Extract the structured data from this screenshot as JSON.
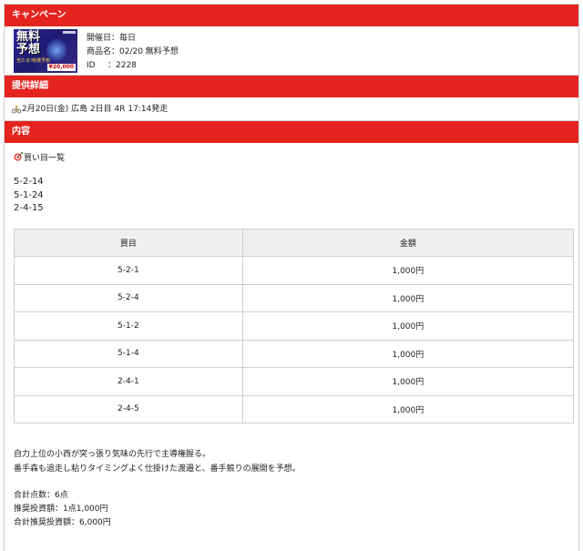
{
  "sections": {
    "campaign_title": "キャンペーン",
    "detail_title": "提供詳細",
    "content_title": "内容"
  },
  "banner": {
    "line1": "無料",
    "line2": "予想",
    "small_text": "当たる!特選予想",
    "price": "¥20,000"
  },
  "campaign": {
    "date": "開催日：毎日",
    "product": "商品名：02/20 無料予想",
    "id_label": "ID",
    "id_value": "：2228"
  },
  "detail": {
    "race_info": "2月20日(金) 広島 2日目 4R 17:14発走"
  },
  "content": {
    "buy_list_title": "買い目一覧",
    "combos": [
      "5-2-14",
      "5-1-24",
      "2-4-15"
    ],
    "table": {
      "headers": [
        "買目",
        "金額"
      ],
      "rows": [
        [
          "5-2-1",
          "1,000円"
        ],
        [
          "5-2-4",
          "1,000円"
        ],
        [
          "5-1-2",
          "1,000円"
        ],
        [
          "5-1-4",
          "1,000円"
        ],
        [
          "2-4-1",
          "1,000円"
        ],
        [
          "2-4-5",
          "1,000円"
        ]
      ]
    },
    "comment_lines": [
      "自力上位の小西が突っ張り気味の先行で主導権握る。",
      "番手森も追走し粘りタイミングよく仕掛けた渡邉と、番手競りの展開を予想。"
    ],
    "totals": [
      "合計点数：6点",
      "推奨投資額：1点1,000円",
      "合計推奨投資額：6,000円"
    ]
  },
  "colors": {
    "accent": "#e52420",
    "table_header_bg": "#efefef",
    "border": "#d0d0d0"
  },
  "icons": {
    "race": "bicycle-rider-icon",
    "buy_list": "dart-target-icon"
  }
}
